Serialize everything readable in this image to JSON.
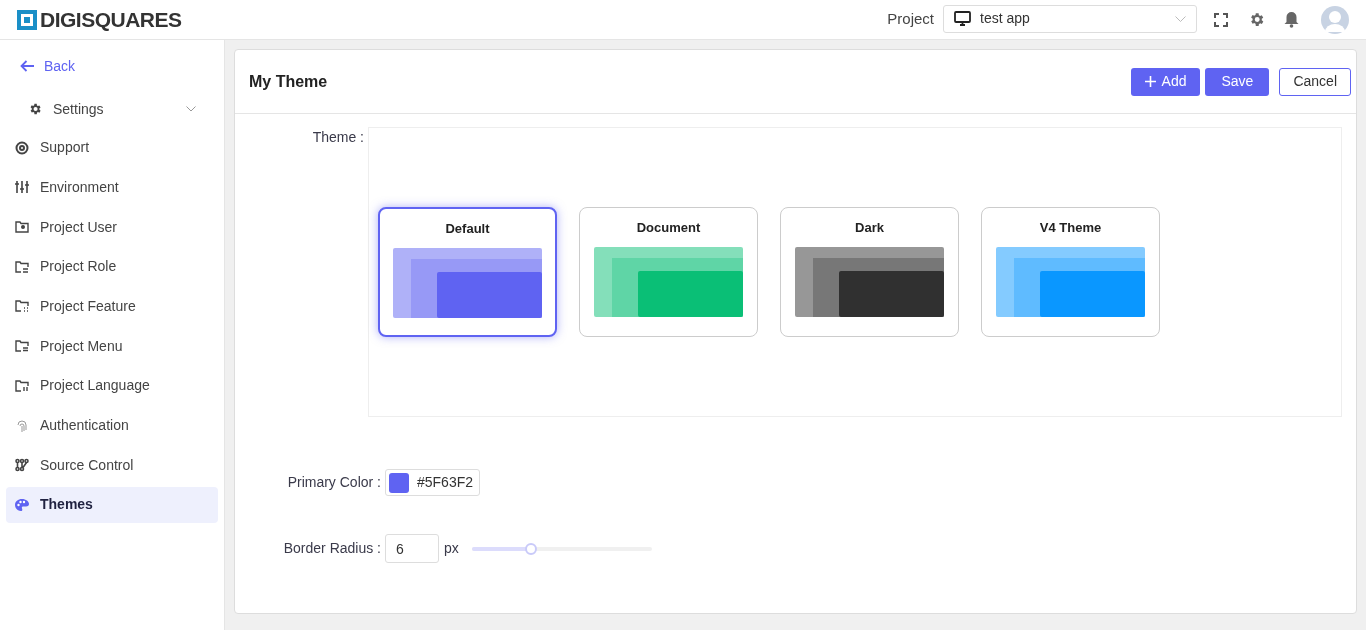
{
  "header": {
    "logo": "DIGISQUARES",
    "project_label": "Project",
    "project_value": "test app"
  },
  "sidebar": {
    "back": "Back",
    "group": {
      "label": "Settings",
      "expanded": true
    },
    "items": [
      {
        "label": "Support",
        "selected": false
      },
      {
        "label": "Environment",
        "selected": false
      },
      {
        "label": "Project User",
        "selected": false
      },
      {
        "label": "Project Role",
        "selected": false
      },
      {
        "label": "Project Feature",
        "selected": false
      },
      {
        "label": "Project Menu",
        "selected": false
      },
      {
        "label": "Project Language",
        "selected": false
      },
      {
        "label": "Authentication",
        "selected": false
      },
      {
        "label": "Source Control",
        "selected": false
      },
      {
        "label": "Themes",
        "selected": true
      }
    ]
  },
  "page": {
    "title": "My Theme",
    "buttons": {
      "add": "Add",
      "save": "Save",
      "cancel": "Cancel"
    },
    "theme_label": "Theme :",
    "themes": [
      {
        "name": "Default",
        "color": "#5f63f2",
        "selected": true
      },
      {
        "name": "Document",
        "color": "#0abf76",
        "selected": false
      },
      {
        "name": "Dark",
        "color": "#303030",
        "selected": false
      },
      {
        "name": "V4 Theme",
        "color": "#0a97ff",
        "selected": false
      }
    ],
    "primary_color": {
      "label": "Primary Color :",
      "value": "#5F63F2",
      "color": "#5f63f2"
    },
    "border_radius": {
      "label": "Border Radius :",
      "value": "6",
      "unit": "px",
      "level": 0.33
    }
  }
}
